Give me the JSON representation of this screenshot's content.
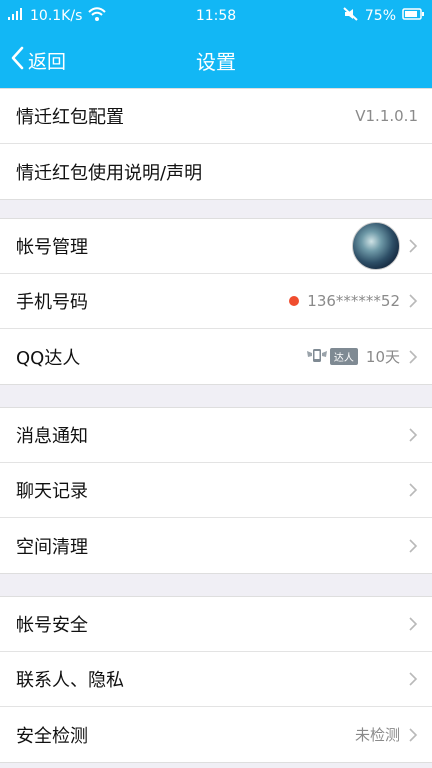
{
  "status_bar": {
    "speed": "10.1K/s",
    "time": "11:58",
    "battery": "75%"
  },
  "nav": {
    "back_label": "返回",
    "title": "设置"
  },
  "sections": [
    {
      "items": [
        {
          "label": "情迁红包配置",
          "value": "V1.1.0.1"
        },
        {
          "label": "情迁红包使用说明/声明",
          "value": ""
        }
      ]
    },
    {
      "items": [
        {
          "label": "帐号管理"
        },
        {
          "label": "手机号码",
          "value": "136******52"
        },
        {
          "label": "QQ达人",
          "badge": "达人",
          "value": "10天"
        }
      ]
    },
    {
      "items": [
        {
          "label": "消息通知"
        },
        {
          "label": "聊天记录"
        },
        {
          "label": "空间清理"
        }
      ]
    },
    {
      "items": [
        {
          "label": "帐号安全"
        },
        {
          "label": "联系人、隐私"
        },
        {
          "label": "安全检测",
          "value": "未检测"
        }
      ]
    }
  ],
  "colors": {
    "header": "#12b7f5",
    "dot": "#f04d2e"
  }
}
